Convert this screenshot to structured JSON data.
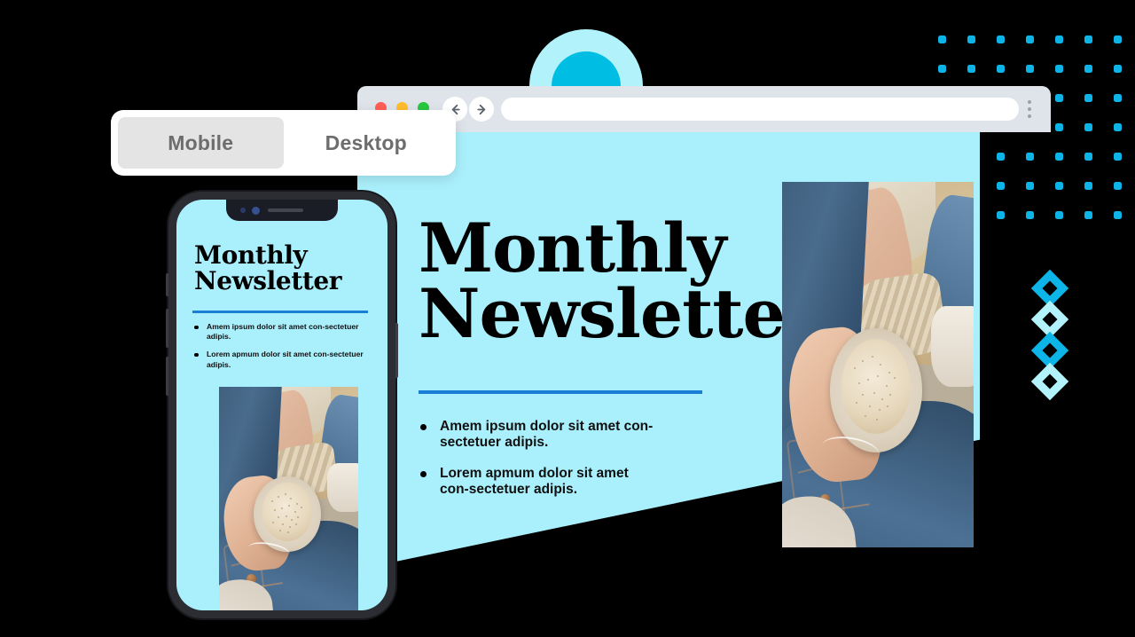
{
  "viewport_toggle": {
    "options": [
      {
        "label": "Mobile",
        "active": true,
        "name": "mobile"
      },
      {
        "label": "Desktop",
        "active": false,
        "name": "desktop"
      }
    ]
  },
  "browser": {
    "traffic_lights": [
      {
        "name": "close",
        "color": "#ff5f57"
      },
      {
        "name": "minimize",
        "color": "#ffbd2e"
      },
      {
        "name": "maximize",
        "color": "#28c840"
      }
    ],
    "back_icon": "arrow-left-icon",
    "forward_icon": "arrow-right-icon",
    "url_value": "",
    "url_placeholder": "",
    "search_icon": "search-icon",
    "menu_icon": "kebab-menu-icon"
  },
  "desktop_preview": {
    "title_line1": "Monthly",
    "title_line2": "Newsletter",
    "bullets": [
      "Amem ipsum dolor sit amet con-sectetuer adipis.",
      "Lorem apmum dolor sit amet con-sectetuer adipis."
    ],
    "photo_alt": "hand holding a latte cup resting on denim jeans"
  },
  "mobile_preview": {
    "title_line1": "Monthly",
    "title_line2": "Newsletter",
    "bullets": [
      "Amem ipsum dolor sit amet con-sectetuer adipis.",
      "Lorem apmum dolor sit amet con-sectetuer adipis."
    ],
    "photo_alt": "hand holding a latte cup resting on denim jeans"
  },
  "colors": {
    "panel_cyan": "#aaf0fc",
    "accent_cyan": "#0db4e8",
    "light_cyan": "#b2f2fb",
    "divider_blue": "#1a7fd4",
    "background": "#000000",
    "browser_chrome": "#dfe3ea",
    "toggle_active": "#e4e4e4"
  },
  "decorations": {
    "dot_grid": {
      "columns": 7,
      "rows": 7,
      "spacing": 33,
      "dot_size": 9
    },
    "diamonds": [
      "solid",
      "light",
      "solid",
      "light"
    ],
    "semicircle": "arch-shape"
  }
}
